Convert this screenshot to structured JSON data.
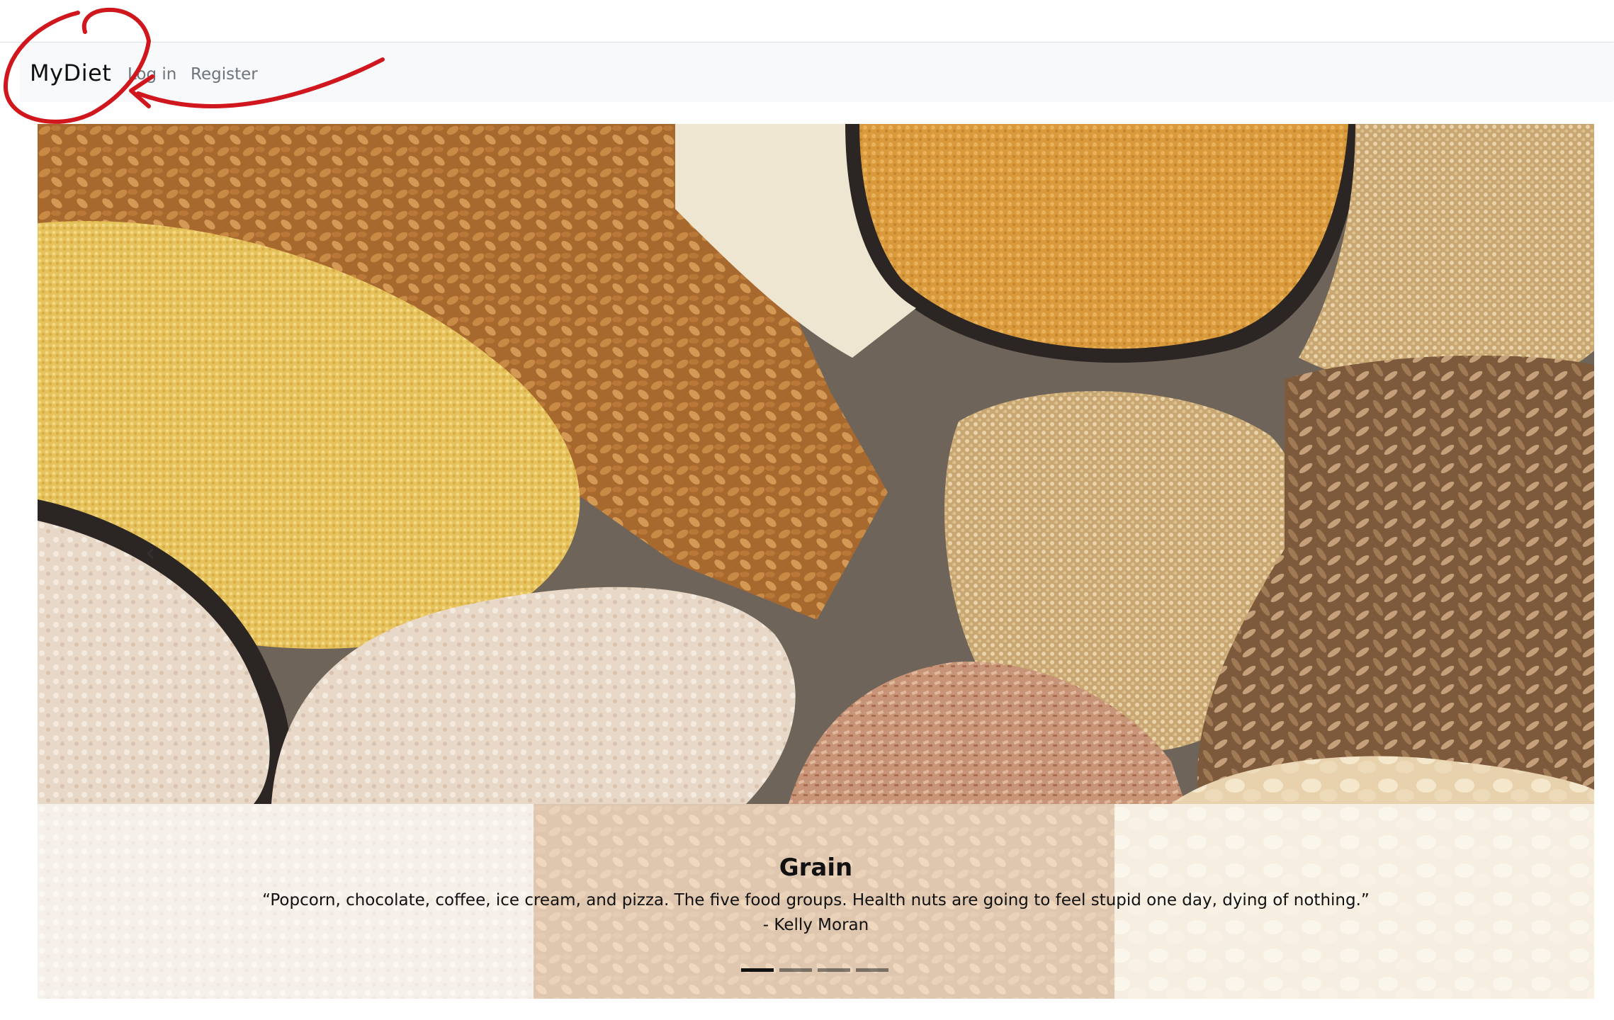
{
  "navbar": {
    "brand": "MyDiet",
    "links": [
      {
        "label": "Log in"
      },
      {
        "label": "Register"
      }
    ]
  },
  "carousel": {
    "active_slide": 1,
    "slide_count": 4,
    "caption": {
      "title": "Grain",
      "quote": "“Popcorn, chocolate, coffee, ice cream, and pizza. The five food groups. Health nuts are going to feel stupid one day, dying of nothing.”",
      "author": "- Kelly Moran"
    },
    "prev_glyph": "‹"
  },
  "colors": {
    "navbar_bg": "#f8f9fa",
    "annotation": "#d0171e",
    "indicator_active": "#111111",
    "link_muted": "#6c757d"
  }
}
